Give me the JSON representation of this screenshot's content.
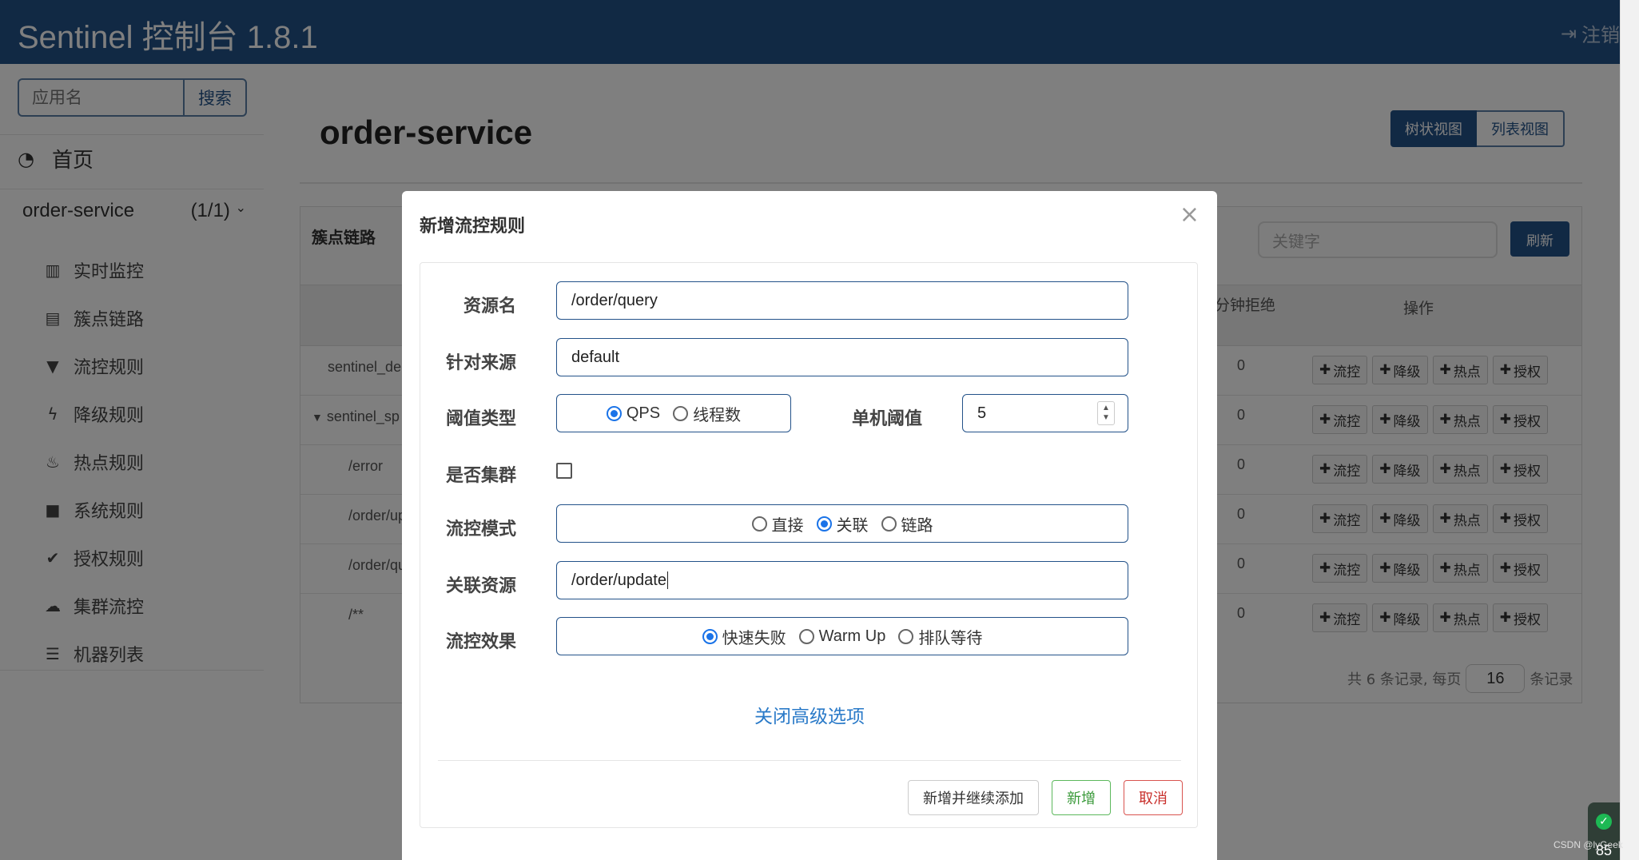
{
  "header": {
    "title": "Sentinel 控制台 1.8.1",
    "logout_label": "注销"
  },
  "sidebar": {
    "search_placeholder": "应用名",
    "search_button": "搜索",
    "home_label": "首页",
    "app_name": "order-service",
    "app_count": "(1/1)",
    "items": [
      {
        "label": "实时监控",
        "icon": "bar-chart-icon"
      },
      {
        "label": "簇点链路",
        "icon": "list-alt-icon"
      },
      {
        "label": "流控规则",
        "icon": "filter-icon"
      },
      {
        "label": "降级规则",
        "icon": "lightning-icon"
      },
      {
        "label": "热点规则",
        "icon": "fire-icon"
      },
      {
        "label": "系统规则",
        "icon": "lock-icon"
      },
      {
        "label": "授权规则",
        "icon": "check-circle-icon"
      },
      {
        "label": "集群流控",
        "icon": "cloud-icon"
      },
      {
        "label": "机器列表",
        "icon": "list-icon"
      }
    ]
  },
  "main": {
    "page_title": "order-service",
    "view_tree": "树状视图",
    "view_list": "列表视图",
    "panel_title": "簇点链路",
    "keyword_placeholder": "关键字",
    "refresh_label": "刷新",
    "col_minute_reject": "分钟拒绝",
    "col_ops": "操作",
    "op_labels": {
      "flow": "流控",
      "degrade": "降级",
      "hot": "热点",
      "auth": "授权"
    },
    "rows": [
      {
        "resource": "sentinel_de",
        "count": "0",
        "expanded": false
      },
      {
        "resource": "sentinel_sp",
        "count": "0",
        "expanded": true
      },
      {
        "resource": "/error",
        "count": "0"
      },
      {
        "resource": "/order/up",
        "count": "0"
      },
      {
        "resource": "/order/qu",
        "count": "0"
      },
      {
        "resource": "/**",
        "count": "0"
      }
    ],
    "pager": {
      "prefix": "共 6 条记录, 每页",
      "page_size": "16",
      "suffix": "条记录"
    }
  },
  "modal": {
    "title": "新增流控规则",
    "close_icon": "close-icon",
    "resource_label": "资源名",
    "resource_value": "/order/query",
    "origin_label": "针对来源",
    "origin_value": "default",
    "threshold_type_label": "阈值类型",
    "threshold_type_options": [
      "QPS",
      "线程数"
    ],
    "threshold_type_selected": "QPS",
    "threshold_label": "单机阈值",
    "threshold_value": "5",
    "cluster_label": "是否集群",
    "cluster_checked": false,
    "mode_label": "流控模式",
    "mode_options": [
      "直接",
      "关联",
      "链路"
    ],
    "mode_selected": "关联",
    "ref_resource_label": "关联资源",
    "ref_resource_value": "/order/update",
    "effect_label": "流控效果",
    "effect_options": [
      "快速失败",
      "Warm Up",
      "排队等待"
    ],
    "effect_selected": "快速失败",
    "advanced_toggle": "关闭高级选项",
    "btn_add_continue": "新增并继续添加",
    "btn_add": "新增",
    "btn_cancel": "取消"
  },
  "widget": {
    "number": "85"
  },
  "watermark": "CSDN @lyGeek",
  "colors": {
    "header_bg": "#235289",
    "primary": "#235289",
    "link": "#2a7ac8",
    "success": "#5cb85c",
    "danger": "#d9534f"
  }
}
